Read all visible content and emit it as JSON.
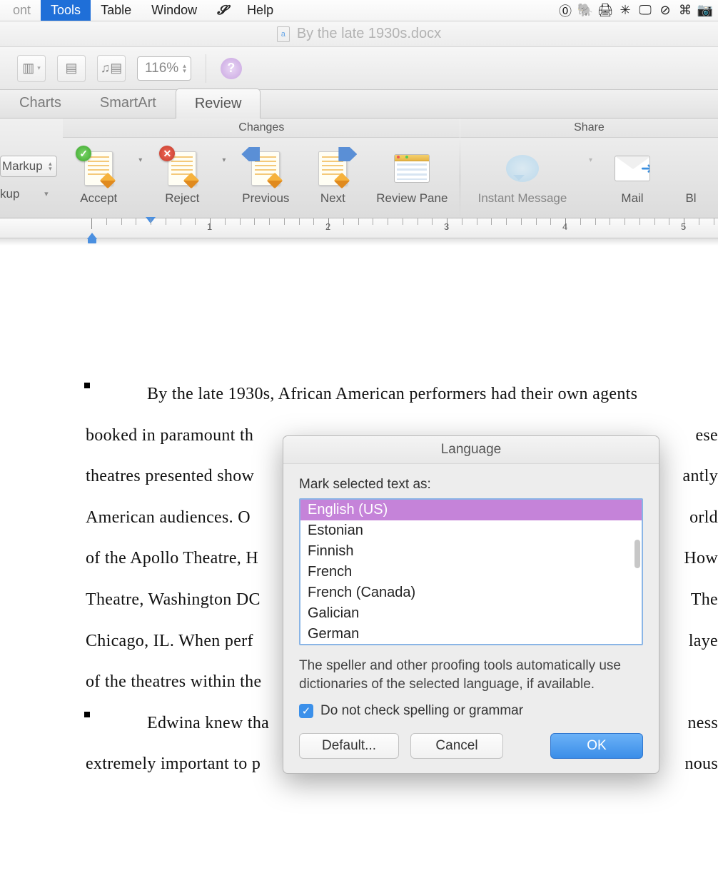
{
  "menubar": {
    "items_left": [
      {
        "label": "ont",
        "partial": true
      },
      {
        "label": "Tools",
        "selected": true
      },
      {
        "label": "Table"
      },
      {
        "label": "Window"
      },
      {
        "label": "",
        "script_icon": true
      },
      {
        "label": "Help"
      }
    ]
  },
  "titlebar": {
    "filename": "By the late 1930s.docx"
  },
  "quickbar": {
    "zoom": "116%"
  },
  "ribbon": {
    "tabs": [
      {
        "label": "Charts"
      },
      {
        "label": "SmartArt"
      },
      {
        "label": "Review",
        "active": true
      }
    ],
    "side": {
      "markup": "Markup",
      "markup2": "kup"
    },
    "changes_label": "Changes",
    "share_label": "Share",
    "buttons": {
      "accept": "Accept",
      "reject": "Reject",
      "previous": "Previous",
      "next": "Next",
      "review_pane": "Review Pane",
      "instant_message": "Instant Message",
      "mail": "Mail",
      "block": "Bl"
    }
  },
  "ruler": {
    "marks": [
      "1",
      "2",
      "3",
      "4",
      "5"
    ]
  },
  "document": {
    "para1_lines": [
      "By the late 1930s, African American performers had their own agents",
      "booked in paramount th",
      "theatres presented show",
      "American audiences.  O",
      "of the Apollo Theatre, H",
      "Theatre, Washington DC",
      "Chicago, IL.  When perf",
      "of the theatres within the"
    ],
    "para1_right_fragments": [
      "ese",
      "antly",
      "orld",
      " How",
      " The",
      "laye",
      "",
      ""
    ],
    "para2_lines": [
      "Edwina knew tha",
      "extremely important to p"
    ],
    "para2_right_fragments": [
      "ness",
      "nous"
    ]
  },
  "dialog": {
    "title": "Language",
    "label": "Mark selected text as:",
    "languages": [
      "English (US)",
      "Estonian",
      "Finnish",
      "French",
      "French (Canada)",
      "Galician",
      "German"
    ],
    "selected_index": 0,
    "note": "The speller and other proofing tools automatically use dictionaries of the selected language, if available.",
    "checkbox_label": "Do not check spelling or grammar",
    "checkbox_checked": true,
    "buttons": {
      "default": "Default...",
      "cancel": "Cancel",
      "ok": "OK"
    }
  }
}
